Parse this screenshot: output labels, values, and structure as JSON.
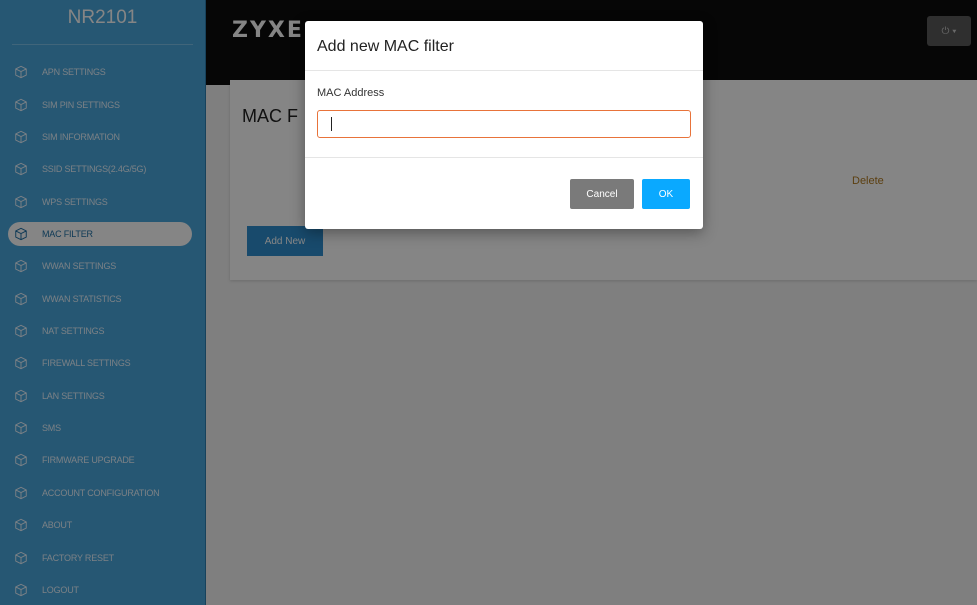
{
  "sidebar": {
    "brand": "NR2101",
    "items": [
      {
        "label": "APN SETTINGS",
        "icon": "cube-icon"
      },
      {
        "label": "SIM PIN SETTINGS",
        "icon": "cube-icon"
      },
      {
        "label": "SIM INFORMATION",
        "icon": "cube-icon"
      },
      {
        "label": "SSID SETTINGS(2.4G/5G)",
        "icon": "cube-icon"
      },
      {
        "label": "WPS SETTINGS",
        "icon": "cube-icon"
      },
      {
        "label": "MAC FILTER",
        "icon": "cube-icon",
        "active": true
      },
      {
        "label": "WWAN SETTINGS",
        "icon": "cube-icon"
      },
      {
        "label": "WWAN STATISTICS",
        "icon": "cube-icon"
      },
      {
        "label": "NAT SETTINGS",
        "icon": "cube-icon"
      },
      {
        "label": "FIREWALL SETTINGS",
        "icon": "cube-icon"
      },
      {
        "label": "LAN SETTINGS",
        "icon": "cube-icon"
      },
      {
        "label": "SMS",
        "icon": "cube-icon"
      },
      {
        "label": "FIRMWARE UPGRADE",
        "icon": "cube-icon"
      },
      {
        "label": "ACCOUNT CONFIGURATION",
        "icon": "cube-icon"
      },
      {
        "label": "ABOUT",
        "icon": "cube-icon"
      },
      {
        "label": "FACTORY RESET",
        "icon": "cube-icon"
      },
      {
        "label": "LOGOUT",
        "icon": "cube-icon"
      }
    ]
  },
  "header": {
    "logo": "ZYXE",
    "power_menu": "⏻ ▾"
  },
  "main": {
    "title": "MAC F",
    "column_delete": "Delete",
    "add_new_label": "Add New"
  },
  "modal": {
    "title": "Add new MAC filter",
    "field_label": "MAC Address",
    "field_value": "",
    "cancel_label": "Cancel",
    "ok_label": "OK"
  },
  "colors": {
    "sidebar_bg": "#4aa7dd",
    "header_bg": "#0d0d0d",
    "ok_button": "#0aa9ff",
    "cancel_button": "#7a7a7a",
    "input_focus_border": "#e8733a",
    "add_new_button": "#2f8fd0"
  }
}
